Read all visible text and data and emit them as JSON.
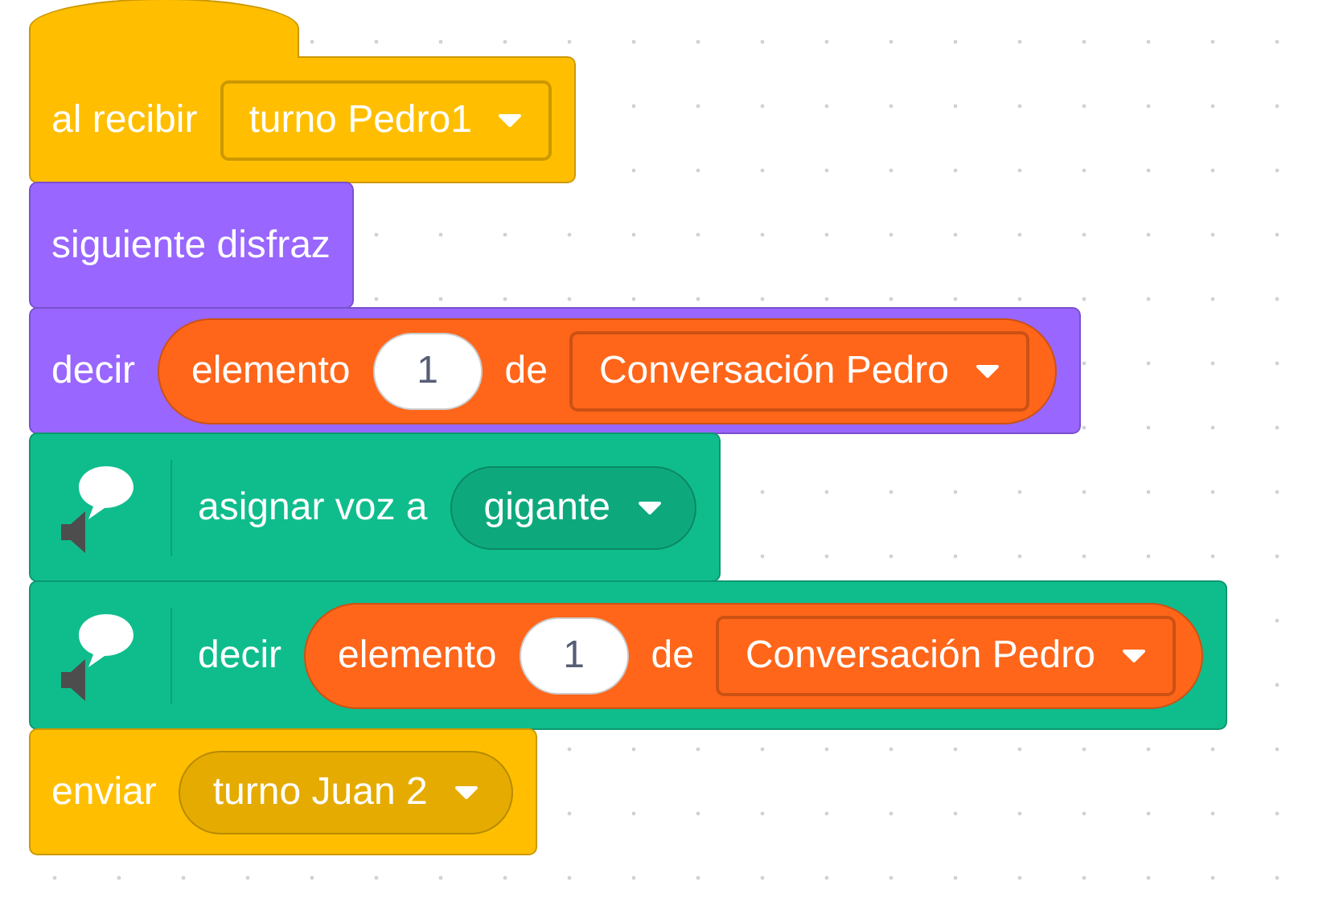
{
  "script": {
    "blocks": [
      {
        "kind": "hat",
        "color": "#ffbf00",
        "parts": [
          {
            "kind": "label",
            "text": "al recibir"
          },
          {
            "kind": "menu",
            "text": "turno Pedro1"
          }
        ]
      },
      {
        "kind": "stack",
        "color": "#9966ff",
        "parts": [
          {
            "kind": "label",
            "text": "siguiente disfraz"
          }
        ]
      },
      {
        "kind": "stack",
        "color": "#9966ff",
        "parts": [
          {
            "kind": "label",
            "text": "decir"
          },
          {
            "kind": "reporter",
            "color": "#ff661a",
            "parts": [
              {
                "kind": "label",
                "text": "elemento"
              },
              {
                "kind": "number",
                "text": "1"
              },
              {
                "kind": "label",
                "text": "de"
              },
              {
                "kind": "menu",
                "text": "Conversación Pedro"
              }
            ]
          }
        ]
      },
      {
        "kind": "extension",
        "color": "#0fbd8c",
        "parts": [
          {
            "kind": "label",
            "text": "asignar voz a"
          },
          {
            "kind": "round_menu",
            "text": "gigante"
          }
        ]
      },
      {
        "kind": "extension",
        "color": "#0fbd8c",
        "parts": [
          {
            "kind": "label",
            "text": "decir"
          },
          {
            "kind": "reporter",
            "color": "#ff661a",
            "parts": [
              {
                "kind": "label",
                "text": "elemento"
              },
              {
                "kind": "number",
                "text": "1"
              },
              {
                "kind": "label",
                "text": "de"
              },
              {
                "kind": "menu",
                "text": "Conversación Pedro"
              }
            ]
          }
        ]
      },
      {
        "kind": "stack",
        "color": "#ffbf00",
        "parts": [
          {
            "kind": "label",
            "text": "enviar"
          },
          {
            "kind": "round_menu",
            "text": "turno Juan 2"
          }
        ]
      }
    ]
  }
}
